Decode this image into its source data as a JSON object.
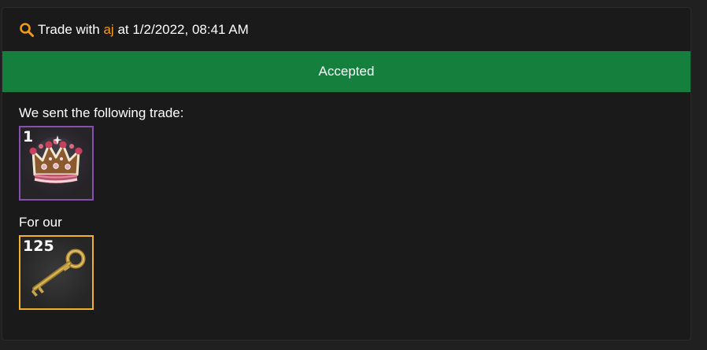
{
  "trade": {
    "prefix": "Trade with",
    "user": "aj",
    "suffix": "at 1/2/2022, 08:41 AM"
  },
  "status": {
    "label": "Accepted",
    "color": "#15803d"
  },
  "sent": {
    "label": "We sent the following trade:",
    "items": [
      {
        "quantity": "1",
        "icon": "crown-icon",
        "quality_color": "#8650ac"
      }
    ]
  },
  "received": {
    "label": "For our",
    "items": [
      {
        "quantity": "125",
        "icon": "key-icon",
        "quality_color": "#f0b22b"
      }
    ]
  },
  "colors": {
    "username": "#f39c12",
    "search_icon": "#f39c12"
  }
}
